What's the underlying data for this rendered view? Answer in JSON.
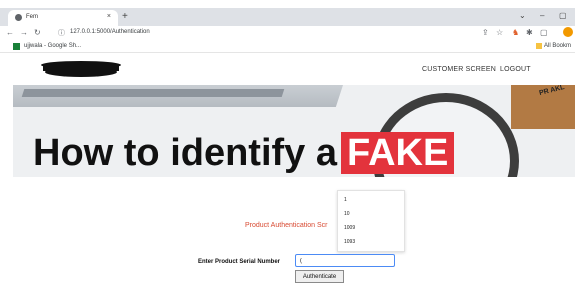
{
  "browser": {
    "tab_title": "Fem",
    "tab_close": "×",
    "new_tab": "+",
    "window_controls": [
      "⌄",
      "–",
      "▢"
    ],
    "url": "127.0.0.1:5000/Authentication",
    "bookmark": "ujjwala - Google Sh...",
    "all_bookmarks": "All Bookm",
    "profile_initial": ""
  },
  "nav": {
    "customer_screen": "CUSTOMER SCREEN",
    "logout": "LOGOUT"
  },
  "banner": {
    "headline": "How to identify a",
    "fake_word": "FAKE",
    "box_label": "PR AKL"
  },
  "form": {
    "title": "Product Authentication Scr",
    "serial_label": "Enter Product Serial Number",
    "serial_value": "(",
    "button_label": "Authenticate"
  },
  "autocomplete": {
    "options": [
      "1",
      "10",
      "1009",
      "1093"
    ]
  }
}
